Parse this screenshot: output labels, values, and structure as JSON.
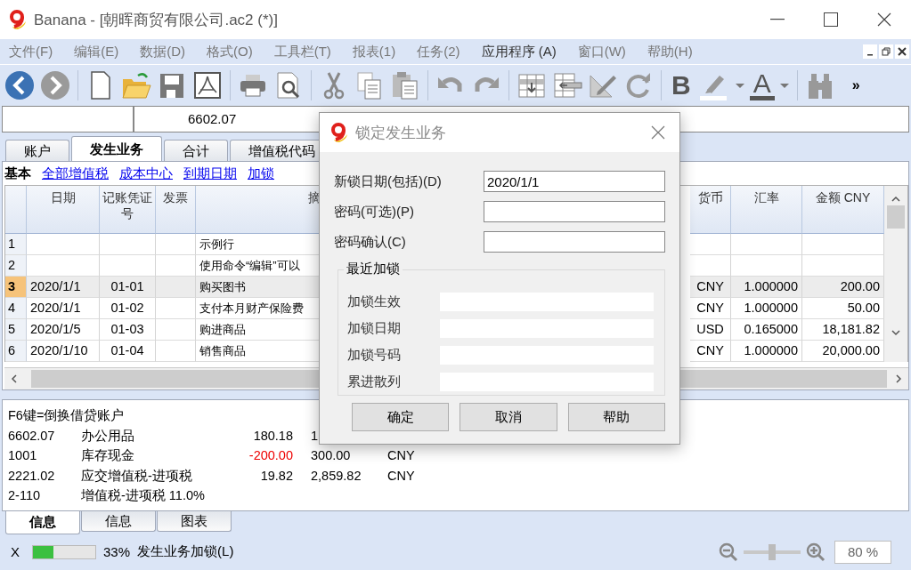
{
  "window": {
    "title": "Banana - [朝晖商贸有限公司.ac2 (*)]"
  },
  "menu": [
    {
      "label": "文件(F)",
      "disabled": true
    },
    {
      "label": "编辑(E)",
      "disabled": true
    },
    {
      "label": "数据(D)",
      "disabled": true
    },
    {
      "label": "格式(O)",
      "disabled": true
    },
    {
      "label": "工具栏(T)",
      "disabled": true
    },
    {
      "label": "报表(1)",
      "disabled": true
    },
    {
      "label": "任务(2)",
      "disabled": true
    },
    {
      "label": "应用程序 (A)",
      "disabled": false
    },
    {
      "label": "窗口(W)",
      "disabled": true
    },
    {
      "label": "帮助(H)",
      "disabled": true
    }
  ],
  "toolbar": {
    "bold": "B",
    "font_color": "A",
    "overflow": "»"
  },
  "formula_bar": {
    "value": "6602.07"
  },
  "tabs": [
    {
      "label": "账户",
      "selected": false
    },
    {
      "label": "发生业务",
      "selected": true
    },
    {
      "label": "合计",
      "selected": false
    },
    {
      "label": "增值税代码",
      "selected": false
    }
  ],
  "views": [
    {
      "label": "基本",
      "selected": true
    },
    {
      "label": "全部增值税",
      "selected": false
    },
    {
      "label": "成本中心",
      "selected": false
    },
    {
      "label": "到期日期",
      "selected": false
    },
    {
      "label": "加锁",
      "selected": false
    }
  ],
  "table": {
    "columns": [
      "日期",
      "记账凭证号",
      "发票",
      "摘",
      "货币",
      "汇率",
      "金额 CNY"
    ],
    "rows": [
      {
        "number": "1",
        "description": "示例行",
        "selected": false
      },
      {
        "number": "2",
        "description": "使用命令“编辑”可以",
        "selected": false
      },
      {
        "number": "3",
        "date": "2020/1/1",
        "voucher": "01-01",
        "description": "购买图书",
        "currency": "CNY",
        "rate": "1.000000",
        "amount": "200.00",
        "selected": true
      },
      {
        "number": "4",
        "date": "2020/1/1",
        "voucher": "01-02",
        "description": "支付本月财产保险费",
        "currency": "CNY",
        "rate": "1.000000",
        "amount": "50.00",
        "selected": false
      },
      {
        "number": "5",
        "date": "2020/1/5",
        "voucher": "01-03",
        "description": "购进商品",
        "currency": "USD",
        "rate": "0.165000",
        "amount": "18,181.82",
        "selected": false
      },
      {
        "number": "6",
        "date": "2020/1/10",
        "voucher": "01-04",
        "description": "销售商品",
        "currency": "CNY",
        "rate": "1.000000",
        "amount": "20,000.00",
        "selected": false
      }
    ]
  },
  "info": {
    "hint": "F6键=倒换借贷账户",
    "lines": [
      {
        "account": "6602.07",
        "name": "办公用品",
        "amount": "180.18",
        "balance": "1",
        "negative": false
      },
      {
        "account": "1001",
        "name": "库存现金",
        "amount": "-200.00",
        "balance": "300.00",
        "currency": "CNY",
        "negative": true
      },
      {
        "account": "2221.02",
        "name": "应交增值税-进项税",
        "amount": "19.82",
        "balance": "2,859.82",
        "currency": "CNY",
        "negative": false
      },
      {
        "account": "2-110",
        "name": "增值税-进项税 11.0%"
      }
    ]
  },
  "info_tabs": [
    {
      "label": "信息",
      "selected": true
    },
    {
      "label": "信息",
      "selected": false
    },
    {
      "label": "图表",
      "selected": false
    }
  ],
  "status_bar": {
    "close": "X",
    "progress": {
      "level": 0.33
    },
    "percent": "33%",
    "message": "发生业务加锁(L)",
    "zoom": {
      "level": 0.5
    },
    "zoom_value": "80 %"
  },
  "dialog": {
    "title": "锁定发生业务",
    "fields": [
      {
        "label": "新锁日期(包括)(D)",
        "value": "2020/1/1"
      },
      {
        "label": "密码(可选)(P)"
      },
      {
        "label": "密码确认(C)"
      }
    ],
    "group": {
      "title": "最近加锁",
      "rows": [
        "加锁生效",
        "加锁日期",
        "加锁号码",
        "累进散列"
      ]
    },
    "buttons": [
      "确定",
      "取消",
      "帮助"
    ]
  }
}
